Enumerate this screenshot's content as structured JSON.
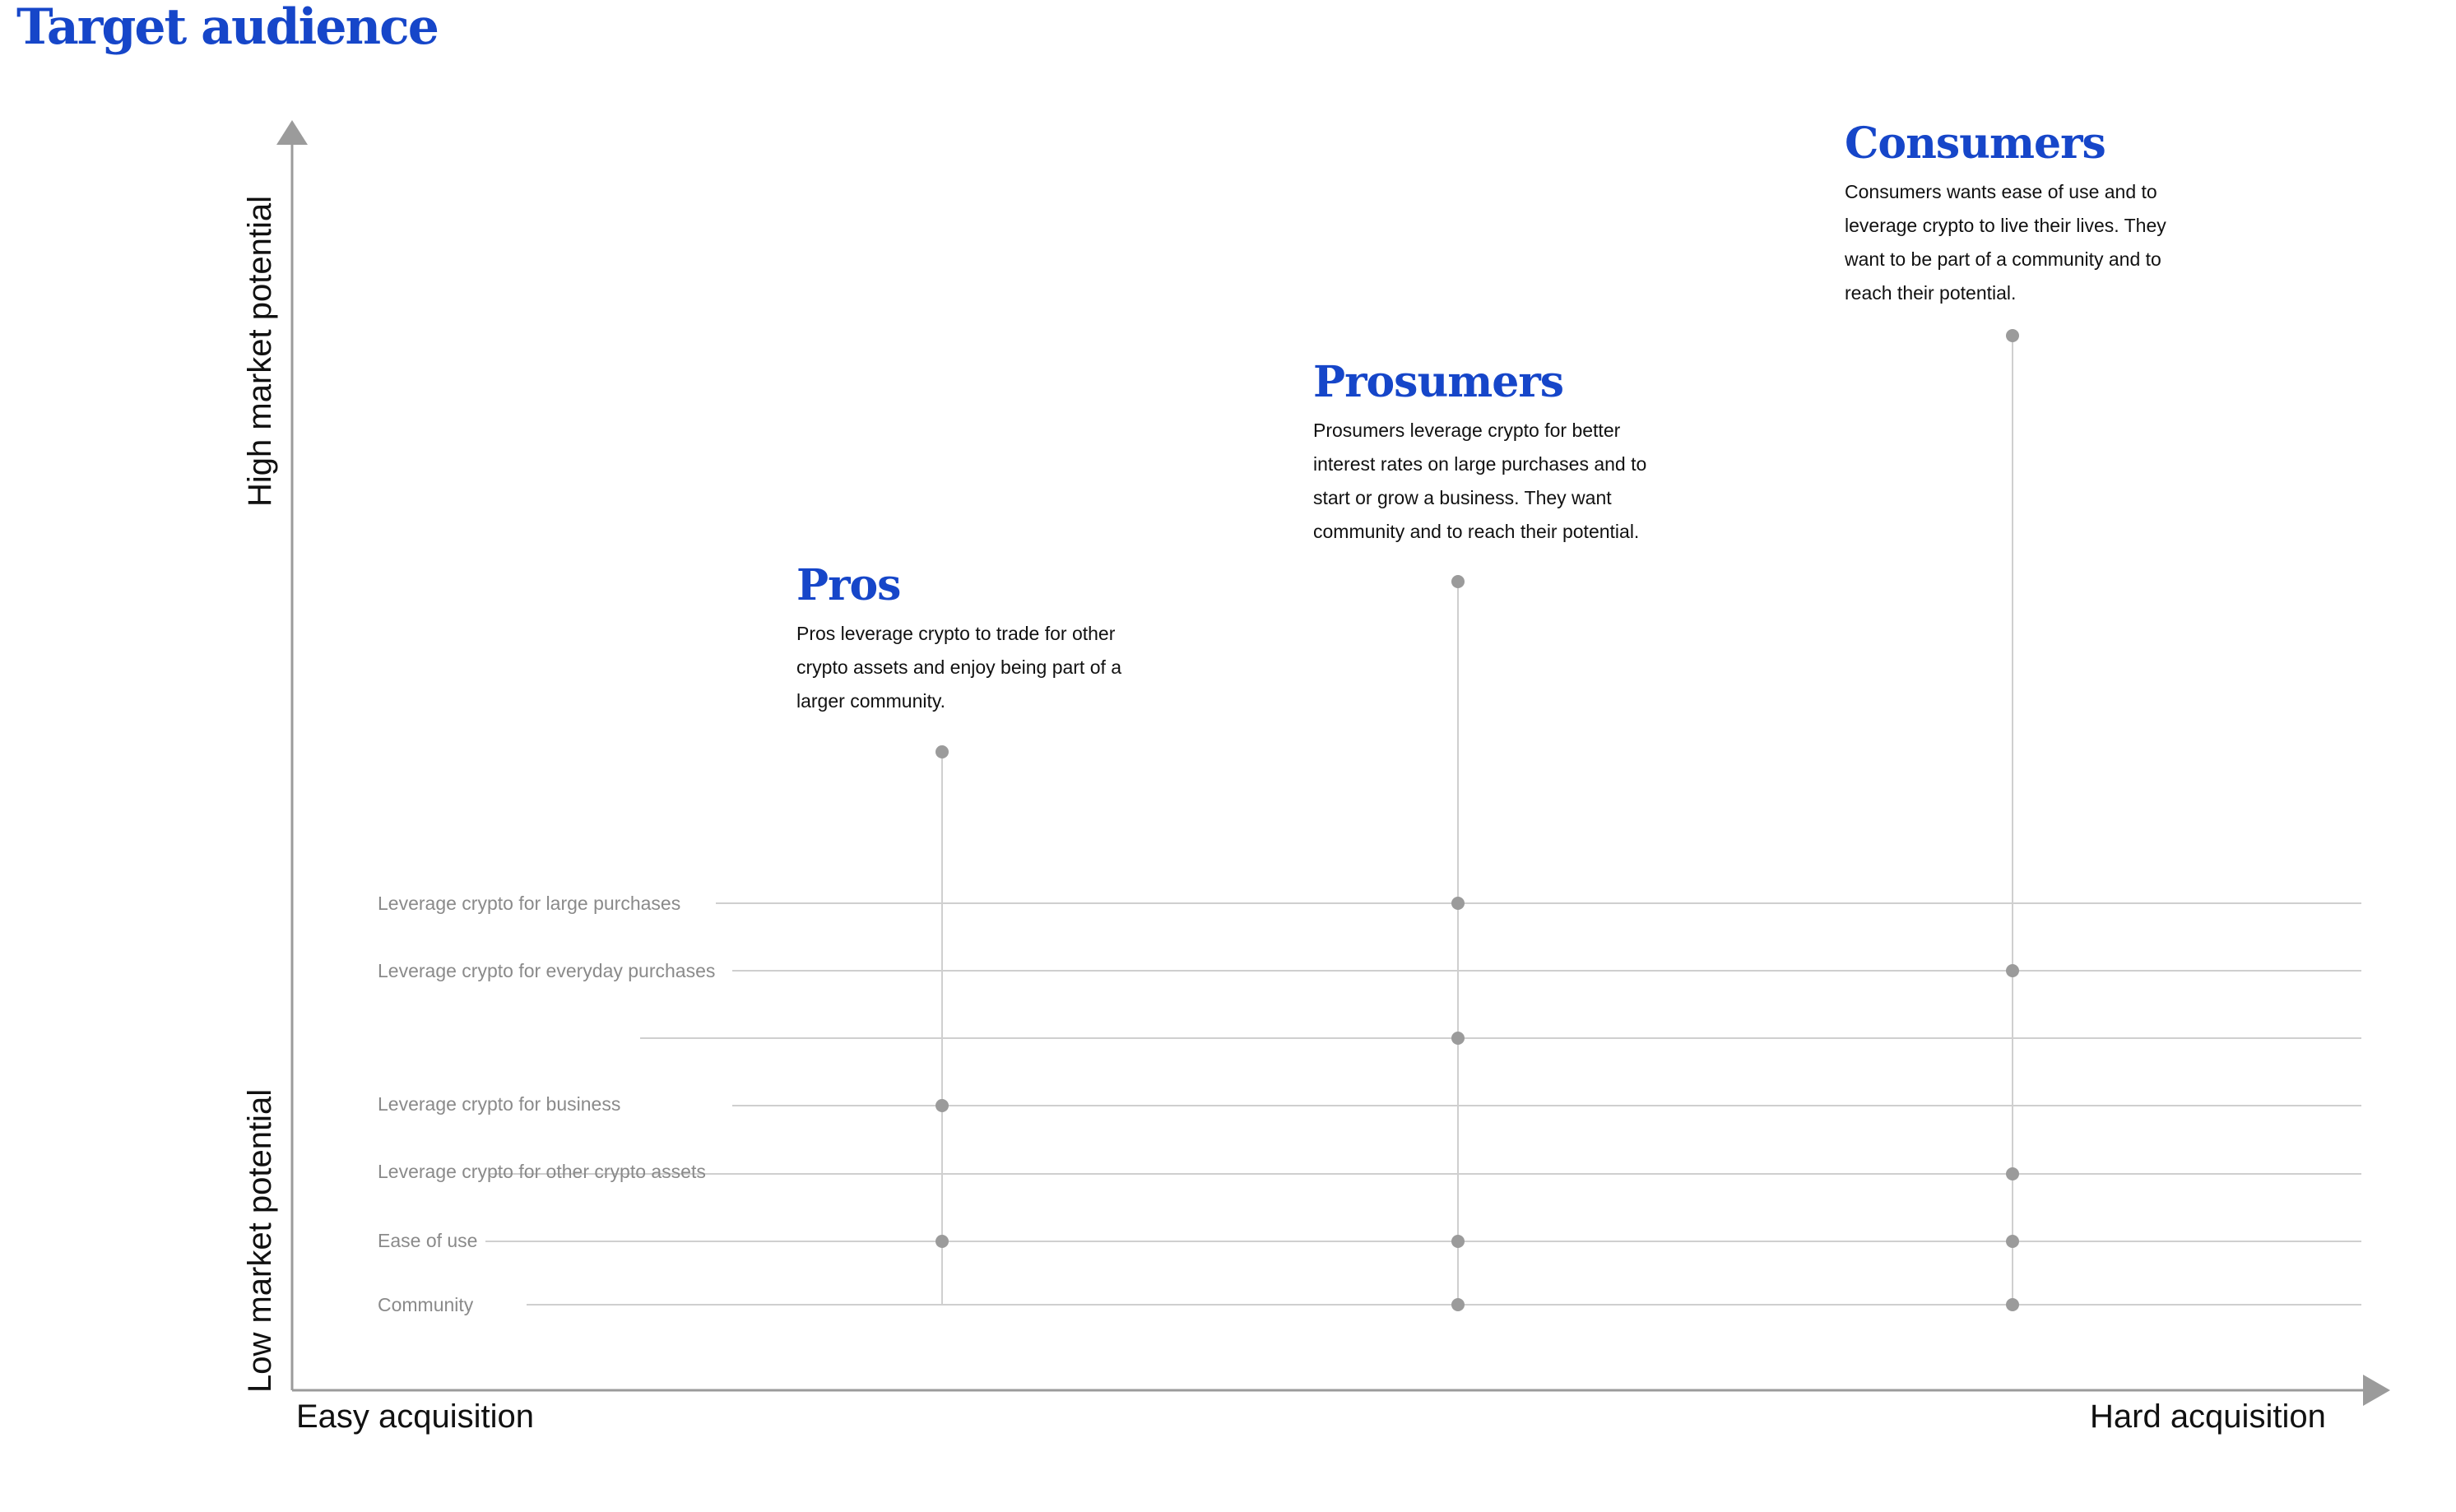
{
  "title": "Target audience",
  "axes": {
    "y_high": "High market potential",
    "y_low": "Low market potential",
    "x_low": "Easy acquisition",
    "x_high": "Hard acquisition"
  },
  "rows": [
    "Leverage crypto for large purchases",
    "Leverage crypto for everyday purchases",
    "Leverage crypto for business",
    "Leverage crypto for other crypto assets",
    "Ease of use",
    "Community"
  ],
  "segments": [
    {
      "id": "pros",
      "title": "Pros",
      "description": "Pros leverage crypto to trade for other crypto assets and enjoy being part of a larger community.",
      "attributes": [
        "Leverage crypto for other crypto assets",
        "Ease of use"
      ]
    },
    {
      "id": "prosumers",
      "title": "Prosumers",
      "description": "Prosumers leverage crypto for better interest rates on large purchases and to start or grow a business. They want community and to reach their potential.",
      "attributes": [
        "Leverage crypto for large purchases",
        "Leverage crypto for business",
        "Ease of use",
        "Community"
      ]
    },
    {
      "id": "consumers",
      "title": "Consumers",
      "description": "Consumers wants ease of use and to leverage crypto to live their lives. They want to be part of a community and to reach their potential.",
      "attributes": [
        "Leverage crypto for everyday purchases",
        "Ease of use",
        "Community"
      ]
    }
  ],
  "colors": {
    "accent": "#1646c9",
    "axis": "#9b9b9b",
    "gridline": "#cfcfcf",
    "dot": "#9b9b9b",
    "row_label": "#8a8a8a"
  }
}
